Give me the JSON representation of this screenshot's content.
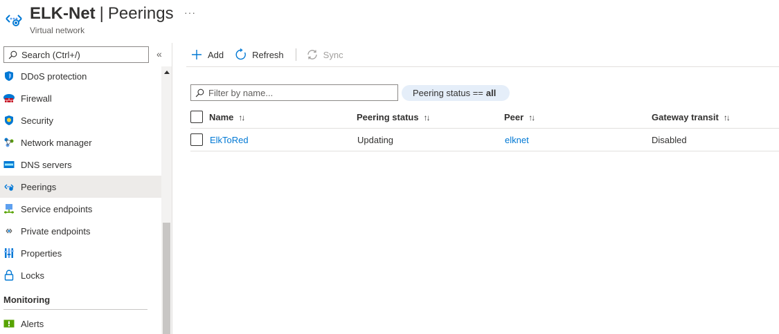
{
  "header": {
    "resource_name": "ELK-Net",
    "separator": "|",
    "page_name": "Peerings",
    "more": "···",
    "resource_type": "Virtual network"
  },
  "sidebar": {
    "search_placeholder": "Search (Ctrl+/)",
    "collapse": "«",
    "items": [
      {
        "label": "DDoS protection",
        "icon": "shield-icon",
        "active": false
      },
      {
        "label": "Firewall",
        "icon": "firewall-icon",
        "active": false
      },
      {
        "label": "Security",
        "icon": "security-shield-icon",
        "active": false
      },
      {
        "label": "Network manager",
        "icon": "network-manager-icon",
        "active": false
      },
      {
        "label": "DNS servers",
        "icon": "dns-servers-icon",
        "active": false
      },
      {
        "label": "Peerings",
        "icon": "peerings-icon",
        "active": true
      },
      {
        "label": "Service endpoints",
        "icon": "service-endpoints-icon",
        "active": false
      },
      {
        "label": "Private endpoints",
        "icon": "private-endpoints-icon",
        "active": false
      },
      {
        "label": "Properties",
        "icon": "properties-icon",
        "active": false
      },
      {
        "label": "Locks",
        "icon": "lock-icon",
        "active": false
      }
    ],
    "monitoring_section": "Monitoring",
    "monitoring_items": [
      {
        "label": "Alerts",
        "icon": "alerts-icon"
      }
    ]
  },
  "toolbar": {
    "add_label": "Add",
    "refresh_label": "Refresh",
    "sync_label": "Sync"
  },
  "filter": {
    "placeholder": "Filter by name...",
    "pill_label": "Peering status ==",
    "pill_value": "all"
  },
  "table": {
    "columns": [
      "Name",
      "Peering status",
      "Peer",
      "Gateway transit"
    ],
    "sort_glyph": "↑↓",
    "rows": [
      {
        "name": "ElkToRed",
        "status": "Updating",
        "peer": "elknet",
        "gateway_transit": "Disabled"
      }
    ]
  },
  "colors": {
    "accent": "#0078d4",
    "active_nav": "#edebe9",
    "pill_bg": "#e5eef9"
  }
}
